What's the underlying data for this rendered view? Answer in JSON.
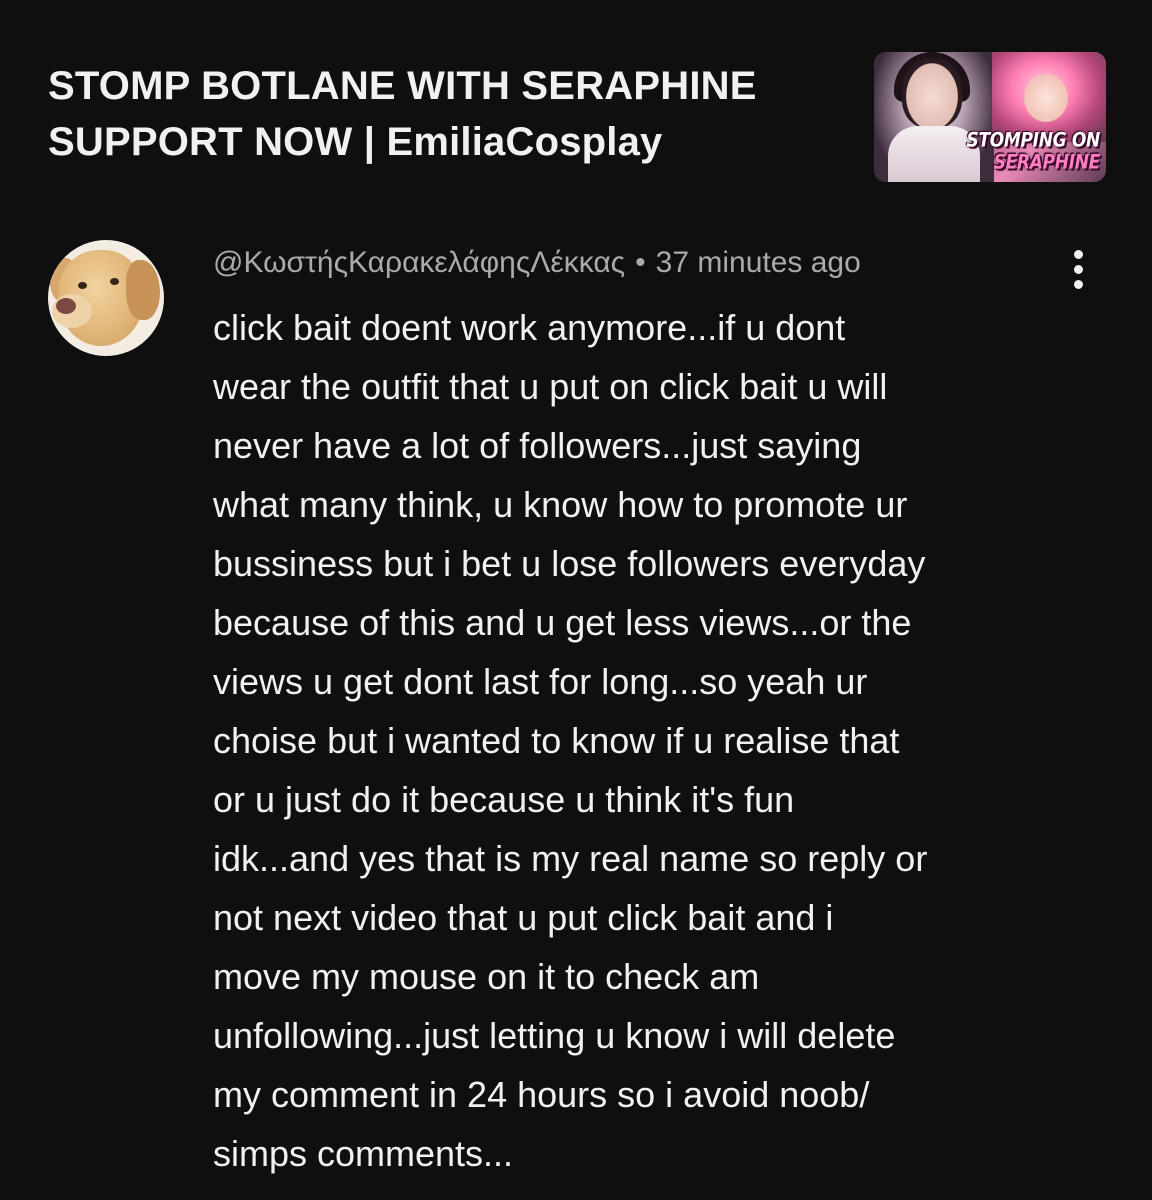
{
  "video": {
    "title": "STOMP BOTLANE WITH SERAPHINE\nSUPPORT NOW  | EmiliaCosplay",
    "thumbnail_caption_line1": "STOMPING ON",
    "thumbnail_caption_line2": "SERAPHINE"
  },
  "comment": {
    "author": "@ΚωστήςΚαρακελάφηςΛέκκας",
    "separator": "•",
    "timestamp": "37 minutes ago",
    "text": "click bait doent work anymore...if u dont\nwear the outfit that u put on click bait u will\nnever have a lot of followers...just saying\nwhat many think, u know how to promote ur\nbussiness but i bet u lose followers everyday\nbecause of this and u get less views...or the\nviews u get dont last for long...so yeah ur\nchoise but i wanted to know if u realise that\nor u just do it because u think it's fun\nidk...and yes that is my real name so reply or\nnot next video that u put click bait and i\nmove my mouse on it to check am\nunfollowing...just letting u know i will delete\nmy comment in 24 hours so i avoid noob/\nsimps comments...",
    "avatar_icon": "dog-avatar",
    "menu_icon": "more-vertical-icon"
  }
}
